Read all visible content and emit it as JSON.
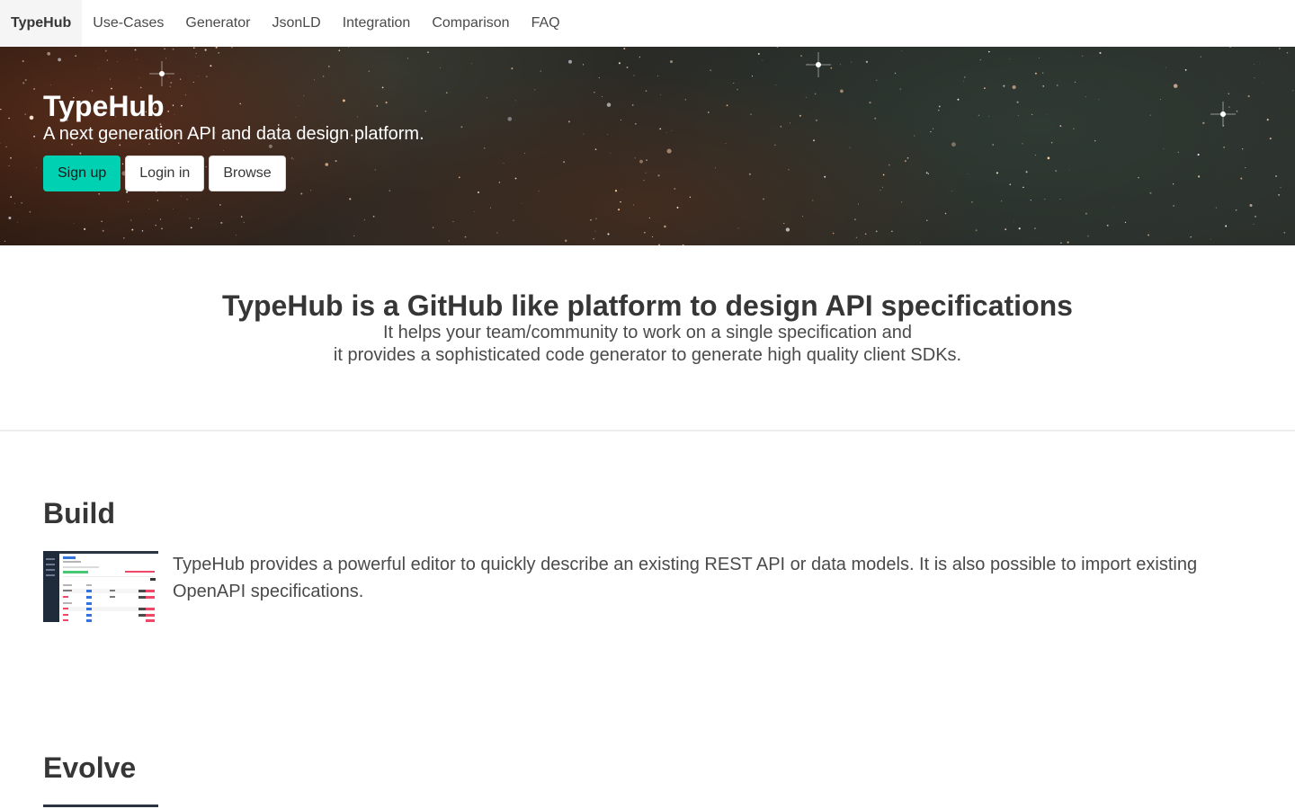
{
  "nav": {
    "brand": "TypeHub",
    "items": [
      "Use-Cases",
      "Generator",
      "JsonLD",
      "Integration",
      "Comparison",
      "FAQ"
    ]
  },
  "hero": {
    "title": "TypeHub",
    "subtitle": "A next generation API and data design platform.",
    "buttons": {
      "signup": "Sign up",
      "login": "Login in",
      "browse": "Browse"
    }
  },
  "intro": {
    "heading": "TypeHub is a GitHub like platform to design API specifications",
    "line1": "It helps your team/community to work on a single specification and",
    "line2": "it provides a sophisticated code generator to generate high quality client SDKs."
  },
  "build": {
    "title": "Build",
    "text": "TypeHub provides a powerful editor to quickly describe an existing REST API or data models. It is also possible to import existing OpenAPI specifications."
  },
  "evolve": {
    "title": "Evolve"
  },
  "colors": {
    "primary": "#00d1b2",
    "text": "#363636",
    "nav_brand_bg": "#f5f5f5"
  }
}
